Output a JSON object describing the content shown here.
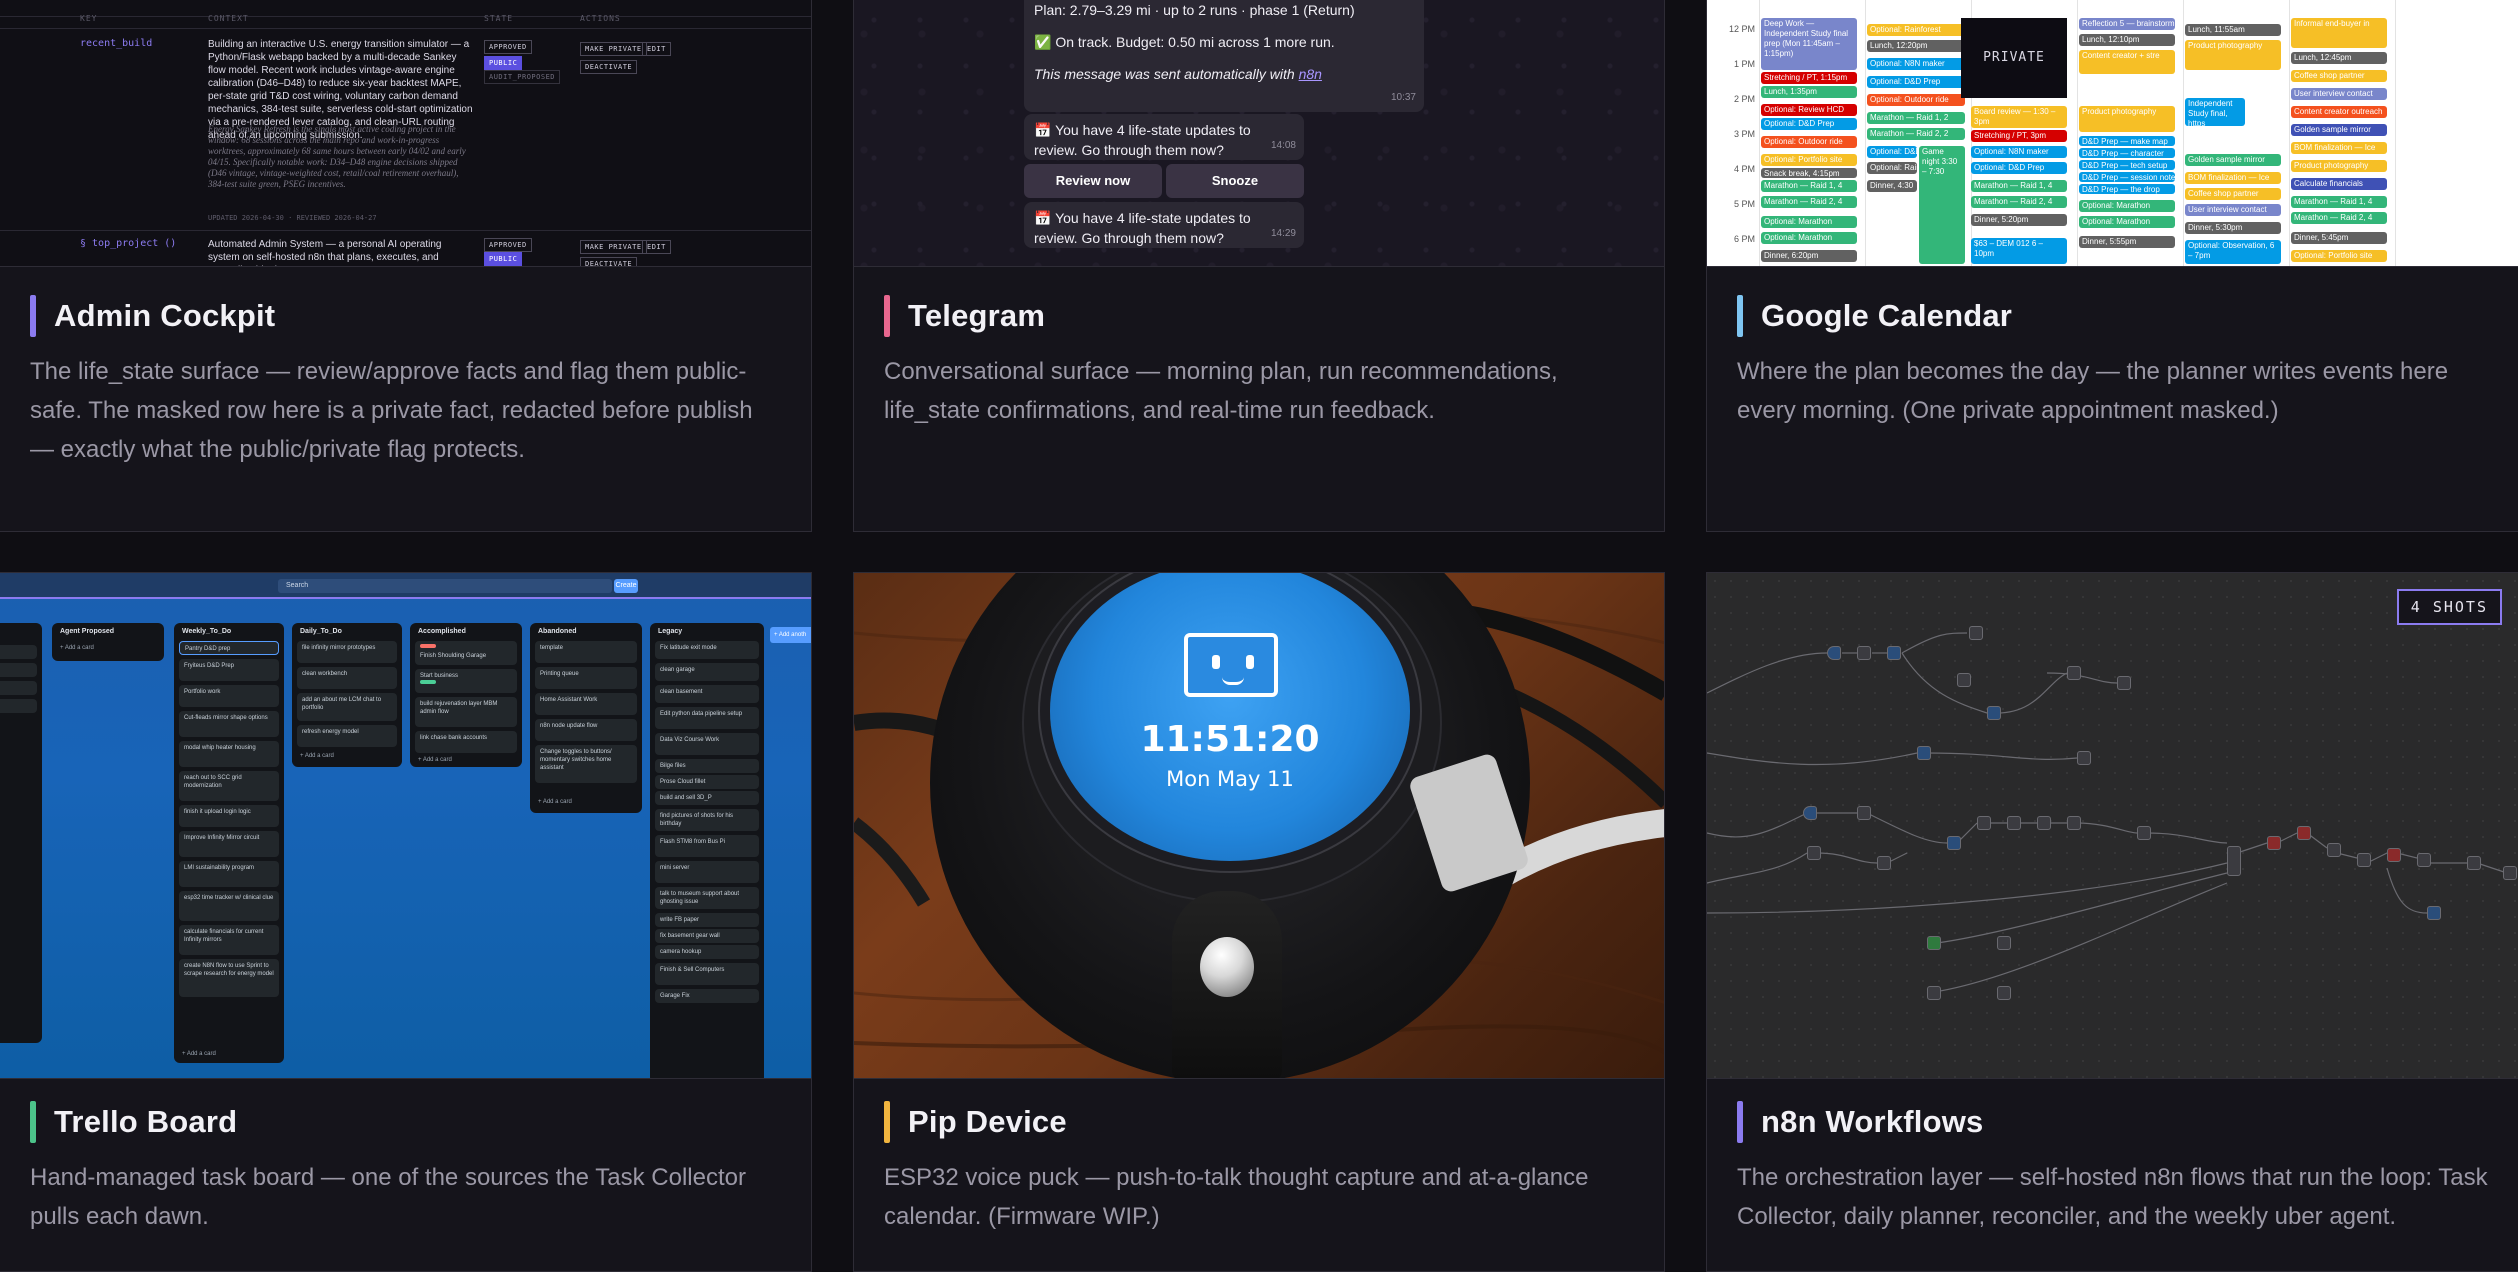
{
  "cards": [
    {
      "title": "Admin Cockpit",
      "description": "The life_state surface — review/approve facts and flag them public-safe. The masked row here is a private fact, redacted before publish — exactly what the public/private flag protects.",
      "accent": "#8b7bf0",
      "screenshot": {
        "headers": [
          "KEY",
          "CONTEXT",
          "STATE",
          "ACTIONS"
        ],
        "rows": [
          {
            "key": "recent_build",
            "text": "Building an interactive U.S. energy transition simulator — a Python/Flask webapp backed by a multi-decade Sankey flow model. Recent work includes vintage-aware engine calibration (D46–D48) to reduce six-year backtest MAPE, per-state grid T&D cost wiring, voluntary carbon demand mechanics, 384-test suite, serverless cold-start optimization via a pre-rendered lever catalog, and clean-URL routing ahead of an upcoming submission.",
            "note": "Energy Sankey Refresh is the single most active coding project in the window: 68 sessions across the main repo and work-in-progress worktrees, approximately 68 same hours between early 04/02 and early 04/15. Specifically notable work: D34–D48 engine decisions shipped (D46 vintage, vintage-weighted cost, retail/coal retirement overhaul), 384-test suite green, PSEG incentives.",
            "meta": "UPDATED 2026-04-30 · REVIEWED 2026-04-27",
            "tags": [
              "APPROVED",
              "PUBLIC",
              "AUDIT_PROPOSED"
            ],
            "actions": [
              "MAKE PRIVATE",
              "EDIT",
              "DEACTIVATE"
            ]
          },
          {
            "key": "§ top_project ()",
            "text": "Automated Admin System — a personal AI operating system on self-hosted n8n that plans, executes, and reconciles his days.",
            "tags": [
              "APPROVED",
              "PUBLIC"
            ],
            "actions": [
              "MAKE PRIVATE",
              "EDIT",
              "DEACTIVATE"
            ]
          }
        ]
      }
    },
    {
      "title": "Telegram",
      "description": "Conversational surface — morning plan, run recommendations, life_state confirmations, and real-time run feedback.",
      "accent": "#e8678f",
      "screenshot": {
        "plan_line": "Plan: 2.79–3.29 mi · up to 2 runs · phase 1 (Return)",
        "status_line": "✅ On track. Budget: 0.50 mi across 1 more run.",
        "auto_line": "This message was sent automatically with",
        "auto_link": "n8n",
        "auto_time": "10:37",
        "messages": [
          {
            "text": "📅 You have 4 life-state updates to review. Go through them now?",
            "time": "14:08"
          },
          {
            "text": "📅 You have 4 life-state updates to review. Go through them now?",
            "time": "14:29"
          }
        ],
        "buttons": [
          "Review now",
          "Snooze"
        ]
      }
    },
    {
      "title": "Google Calendar",
      "description": "Where the plan becomes the day — the planner writes events here every morning. (One private appointment masked.)",
      "accent": "#7fc6f2",
      "screenshot": {
        "times": [
          "12 PM",
          "1 PM",
          "2 PM",
          "3 PM",
          "4 PM",
          "5 PM",
          "6 PM"
        ],
        "private_label": "PRIVATE",
        "events": [
          "Deep Work — Independent Study final prep (Mon 11:45am – 1:15pm)",
          "Stretching / PT, 1:15pm",
          "Lunch, 1:35pm",
          "Optional: Review HCD",
          "Optional: D&D Prep",
          "Optional: Outdoor ride",
          "Optional: Portfolio site",
          "Snack break, 4:15pm",
          "Marathon — Raid 1, 4",
          "Marathon — Raid 2, 4",
          "Optional: Marathon",
          "Optional: Marathon",
          "Dinner, 6:20pm",
          "Optional: Rainforest",
          "Lunch, 12:20pm",
          "Optional: N8N maker",
          "Optional: D&D Prep",
          "Optional: Outdoor ride",
          "Marathon — Raid 1, 2",
          "Marathon — Raid 2, 2",
          "Optional: D&D Prep",
          "Optional: Rainforest",
          "Dinner, 4:30",
          "Game night 3:30 – 7:30",
          "Reflection 5 — brainstorm",
          "Lunch, 12:10pm",
          "Content creator + stre",
          "Board review — 1:30 – 3pm",
          "Stretching / PT, 3pm",
          "Optional: N8N maker",
          "Optional: D&D Prep",
          "Marathon — Raid 1, 4",
          "Marathon — Raid 2, 4",
          "Dinner, 5:20pm",
          "$63 – DEM 012 6 – 10pm",
          "Product photography",
          "D&D Prep — make map",
          "D&D Prep — character",
          "D&D Prep — tech setup",
          "D&D Prep — session notes",
          "D&D Prep — the drop",
          "Optional: Marathon",
          "Optional: Marathon",
          "Dinner, 5:55pm",
          "Lunch, 11:55am",
          "Product photography",
          "Independent Study final, https",
          "Golden sample mirror",
          "BOM finalization — Ice",
          "Coffee shop partner",
          "User interview contact",
          "Dinner, 5:30pm",
          "Optional: Observation, 6 – 7pm",
          "Informal end-buyer in",
          "Lunch, 12:45pm",
          "Coffee shop partner",
          "User interview contact",
          "Content creator outreach",
          "Golden sample mirror",
          "BOM finalization — Ice",
          "Product photography",
          "Calculate financials",
          "Marathon — Raid 1, 4",
          "Marathon — Raid 2, 4",
          "Dinner, 5:45pm",
          "Optional: Portfolio site"
        ]
      }
    },
    {
      "title": "Trello Board",
      "description": "Hand-managed task board — one of the sources the Task Collector pulls each dawn.",
      "accent": "#4cc38a",
      "screenshot": {
        "search_placeholder": "Search",
        "create_label": "Create",
        "add_another": "+ Add anoth",
        "add_card": "+ Add a card",
        "lists": [
          {
            "name": "",
            "cards": []
          },
          {
            "name": "Agent Proposed",
            "cards": []
          },
          {
            "name": "Weekly_To_Do",
            "cards": [
              "Pantry D&D prep",
              "Fryiteus D&D Prep",
              "Portfolio work",
              "Cut-fleads mirror shape options",
              "modal whip heater housing",
              "reach out to SCC grid modernization",
              "finish it upload login logic",
              "Improve Infinity Mirror circuit",
              "LMI sustainability program",
              "esp32 time tracker w/ clinical clue",
              "calculate financials for current Infinity mirrors",
              "create N8N flow to use Sprint to scrape research for energy model"
            ]
          },
          {
            "name": "Daily_To_Do",
            "cards": [
              "file infinity mirror prototypes",
              "clean workbench",
              "add an about me LCM chat to portfolio",
              "refresh energy model"
            ]
          },
          {
            "name": "Accomplished",
            "cards": [
              "Finish Shoulding Garage",
              "Start business",
              "build rejuvenation layer MBM admin flow",
              "link chase bank accounts"
            ]
          },
          {
            "name": "Abandoned",
            "cards": [
              "template",
              "Printing queue",
              "Home Assistant Work",
              "n8n node update flow",
              "Change toggles to buttons/ momentary switches home assistant"
            ]
          },
          {
            "name": "Legacy",
            "cards": [
              "Fix latitude exit mode",
              "clean garage",
              "clean basement",
              "Edit python data pipeline setup",
              "Data Viz Course Work",
              "Bilge files",
              "Prose Cloud fillet",
              "build and sell 3D_P",
              "find pictures of shots for his birthday",
              "Flash STM8 from Bus Pi",
              "mini server",
              "talk to museum support about ghosting issue",
              "write FB paper",
              "fix basement gear wall",
              "camera hookup",
              "Finish & Sell Computers",
              "Garage Fix"
            ]
          }
        ]
      }
    },
    {
      "title": "Pip Device",
      "description": "ESP32 voice puck — push-to-talk thought capture and at-a-glance calendar. (Firmware WIP.)",
      "accent": "#f2b53f",
      "screenshot": {
        "time": "11:51:20",
        "date": "Mon May 11"
      }
    },
    {
      "title": "n8n Workflows",
      "description": "The orchestration layer — self-hosted n8n flows that run the loop: Task Collector, daily planner, reconciler, and the weekly uber agent.",
      "accent": "#8b7bf0",
      "badge": "4 SHOTS"
    }
  ]
}
